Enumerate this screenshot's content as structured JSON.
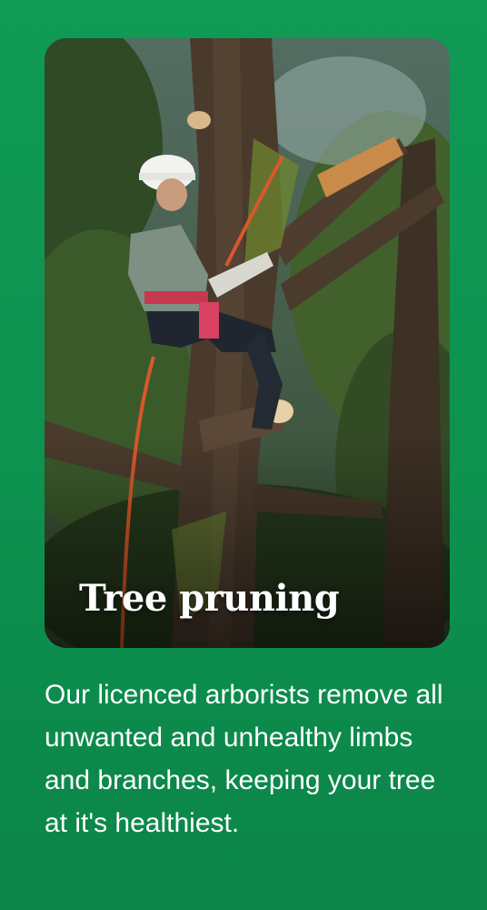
{
  "service": {
    "title": "Tree pruning",
    "description": "Our licenced arborists remove all unwanted and unhealthy limbs and branches, keeping your tree at it's healthiest."
  },
  "colors": {
    "background": "#0f9a55",
    "text": "#ffffff"
  },
  "icons": {
    "photo": "arborist-pruning-tree-photo"
  }
}
